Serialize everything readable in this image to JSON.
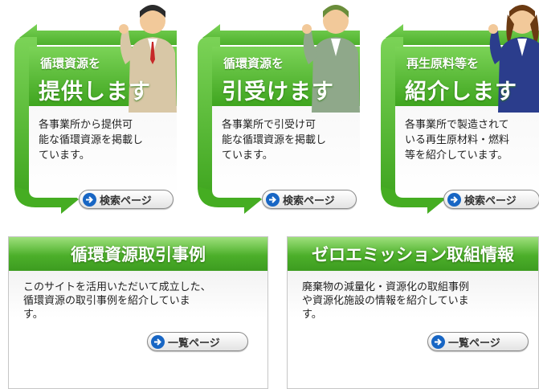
{
  "panels": [
    {
      "small_title": "循環資源を",
      "big_title": "提供します",
      "desc": [
        "各事業所から提供可",
        "能な循環資源を掲載し",
        "ています。"
      ],
      "button_label": "検索ページ"
    },
    {
      "small_title": "循環資源を",
      "big_title": "引受けます",
      "desc": [
        "各事業所で引受け可",
        "能な循環資源を掲載し",
        "ています。"
      ],
      "button_label": "検索ページ"
    },
    {
      "small_title": "再生原料等を",
      "big_title": "紹介します",
      "desc": [
        "各事業所で製造されて",
        "いる再生原材料・燃料",
        "等を紹介しています。"
      ],
      "button_label": "検索ページ"
    }
  ],
  "boxes": [
    {
      "title": "循環資源取引事例",
      "desc": [
        "このサイトを活用いただいて成立した、",
        "循環資源の取引事例を紹介していま",
        "す。"
      ],
      "button_label": "一覧ページ"
    },
    {
      "title": "ゼロエミッション取組情報",
      "desc": [
        "廃棄物の減量化・資源化の取組事例",
        "や資源化施設の情報を紹介していま",
        "す。"
      ],
      "button_label": "一覧ページ"
    }
  ],
  "colors": {
    "arrow_green": "#4cb52a",
    "header_green": "#4caf2a",
    "button_icon_blue": "#1866c4"
  },
  "icons": [
    "arrow-right-circle-icon",
    "man-suit-illustration",
    "worker-cap-illustration",
    "woman-suit-illustration"
  ]
}
